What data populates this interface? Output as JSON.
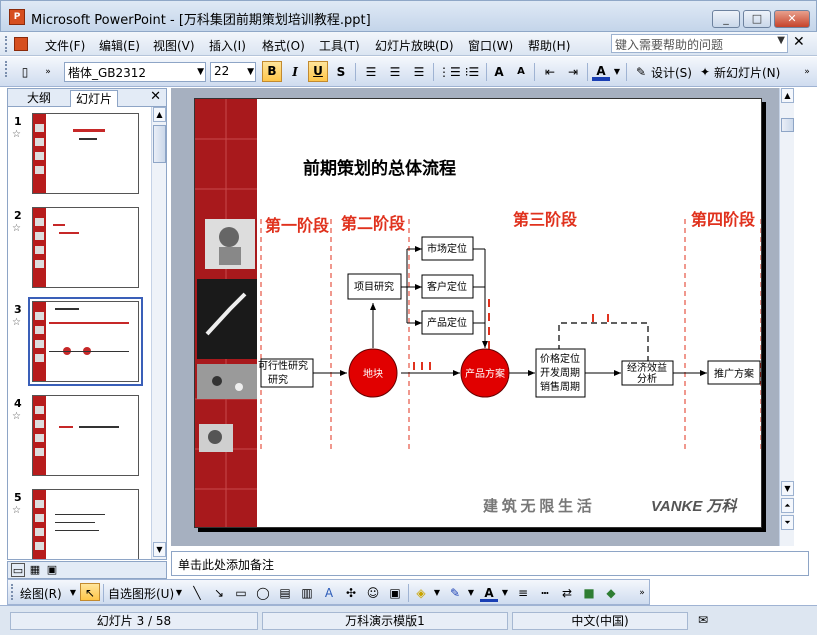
{
  "window": {
    "title": "Microsoft PowerPoint - [万科集团前期策划培训教程.ppt]",
    "app_icon": "powerpoint-icon",
    "min_label": "_",
    "max_label": "□",
    "close_label": "✕"
  },
  "menu": {
    "items": [
      "文件(F)",
      "编辑(E)",
      "视图(V)",
      "插入(I)",
      "格式(O)",
      "工具(T)",
      "幻灯片放映(D)",
      "窗口(W)",
      "帮助(H)"
    ],
    "help_placeholder": "键入需要帮助的问题",
    "close_label": "✕"
  },
  "toolbar": {
    "font": "楷体_GB2312",
    "size": "22",
    "bold": "B",
    "italic": "I",
    "underline": "U",
    "shadow": "S",
    "design": "设计(S)",
    "new_slide": "新幻灯片(N)",
    "grow_font": "A",
    "shrink_font": "A",
    "font_color": "A"
  },
  "pane": {
    "tabs": [
      "大纲",
      "幻灯片"
    ],
    "close_label": "✕",
    "thumbs": [
      {
        "num": "1"
      },
      {
        "num": "2"
      },
      {
        "num": "3"
      },
      {
        "num": "4"
      },
      {
        "num": "5"
      }
    ]
  },
  "slide": {
    "title": "前期策划的总体流程",
    "stages": [
      "第一阶段",
      "第二阶段",
      "第三阶段",
      "第四阶段"
    ],
    "boxes": {
      "feasibility": "可行性研究",
      "project": "项目研究",
      "market": "市场定位",
      "customer": "客户定位",
      "product": "产品定位",
      "pricing_l1": "价格定位",
      "pricing_l2": "开发周期",
      "pricing_l3": "销售周期",
      "econ_l1": "经济效益",
      "econ_l2": "分析",
      "promo": "推广方案"
    },
    "circles": {
      "land": "地块",
      "plan": "产品方案"
    },
    "footer": "建 筑 无 限 生 活",
    "logo": "VANKE 万科",
    "colors": {
      "red": "#e10000",
      "stage": "#e0321e",
      "strip": "#a8191c"
    }
  },
  "notes": "单击此处添加备注",
  "drawbar": {
    "draw": "绘图(R)",
    "autoshape": "自选图形(U)"
  },
  "status": {
    "slide": "幻灯片 3 / 58",
    "template": "万科演示模版1",
    "lang": "中文(中国)"
  }
}
